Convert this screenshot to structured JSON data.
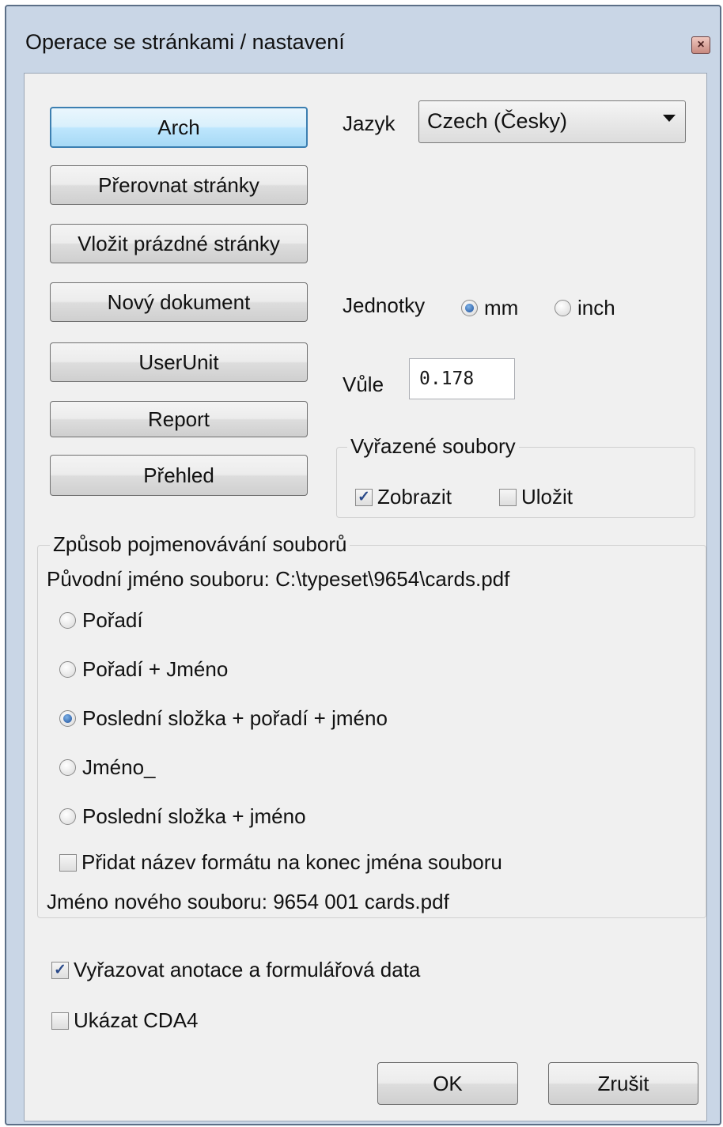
{
  "window": {
    "title": "Operace se stránkami / nastavení",
    "close_glyph": "×"
  },
  "buttons": {
    "arch": "Arch",
    "prerovnat": "Přerovnat stránky",
    "vlozit": "Vložit prázdné stránky",
    "novy": "Nový dokument",
    "userunit": "UserUnit",
    "report": "Report",
    "prehled": "Přehled",
    "ok": "OK",
    "cancel": "Zrušit"
  },
  "language": {
    "label": "Jazyk",
    "selected": "Czech (Česky)"
  },
  "units": {
    "label": "Jednotky",
    "mm": "mm",
    "inch": "inch",
    "selected": "mm"
  },
  "tolerance": {
    "label": "Vůle",
    "value": "0.178"
  },
  "discarded_files": {
    "title": "Vyřazené soubory",
    "show": {
      "label": "Zobrazit",
      "checked": true
    },
    "save": {
      "label": "Uložit",
      "checked": false
    }
  },
  "naming": {
    "title": "Způsob pojmenovávání souborů",
    "original": "Původní jméno souboru: C:\\typeset\\9654\\cards.pdf",
    "options": [
      {
        "label": "Pořadí",
        "selected": false
      },
      {
        "label": "Pořadí + Jméno",
        "selected": false
      },
      {
        "label": "Poslední složka + pořadí + jméno",
        "selected": true
      },
      {
        "label": "Jméno_",
        "selected": false
      },
      {
        "label": "Poslední složka + jméno",
        "selected": false
      }
    ],
    "append_format": {
      "label": "Přidat název formátu na konec jména souboru",
      "checked": false
    },
    "new_name": "Jméno nového souboru: 9654 001 cards.pdf"
  },
  "annotations": {
    "label": "Vyřazovat anotace a formulářová data",
    "checked": true
  },
  "cda4": {
    "label": "Ukázat CDA4",
    "checked": false
  },
  "check_glyph": "✓"
}
